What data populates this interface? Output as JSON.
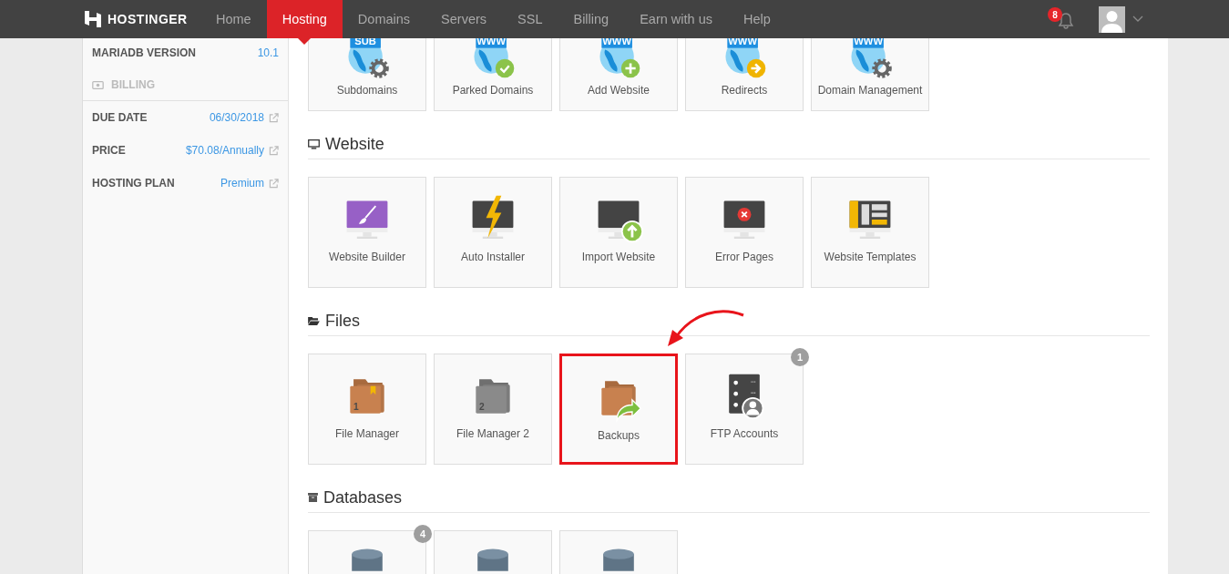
{
  "nav": {
    "logo": "HOSTINGER",
    "items": [
      {
        "label": "Home",
        "selected": false
      },
      {
        "label": "Hosting",
        "selected": true
      },
      {
        "label": "Domains",
        "selected": false
      },
      {
        "label": "Servers",
        "selected": false
      },
      {
        "label": "SSL",
        "selected": false
      },
      {
        "label": "Billing",
        "selected": false
      },
      {
        "label": "Earn with us",
        "selected": false
      },
      {
        "label": "Help",
        "selected": false
      }
    ],
    "notifications": "8"
  },
  "sidebar": {
    "rows": [
      {
        "label": "MARIADB VERSION",
        "value": "10.1",
        "link": false
      }
    ],
    "billing": {
      "title": "BILLING",
      "rows": [
        {
          "label": "DUE DATE",
          "value": "06/30/2018",
          "link": true
        },
        {
          "label": "PRICE",
          "value": "$70.08/Annually",
          "link": true
        },
        {
          "label": "HOSTING PLAN",
          "value": "Premium",
          "link": true
        }
      ]
    }
  },
  "sections": [
    {
      "kind": "globe",
      "tiles": [
        {
          "label": "Subdomains",
          "kind": "gear",
          "icon_text": "SUB",
          "highlighted": false
        },
        {
          "label": "Parked Domains",
          "kind": "check",
          "icon_text": "WWW",
          "highlighted": false
        },
        {
          "label": "Add Website",
          "kind": "plus",
          "icon_text": "WWW",
          "highlighted": false
        },
        {
          "label": "Redirects",
          "kind": "arrow",
          "icon_text": "WWW",
          "highlighted": false
        },
        {
          "label": "Domain Management",
          "kind": "gear",
          "icon_text": "WWW",
          "highlighted": false
        }
      ]
    },
    {
      "kind": "monitor",
      "title": "Website",
      "tiles": [
        {
          "label": "Website Builder",
          "kind": "brush",
          "highlighted": false
        },
        {
          "label": "Auto Installer",
          "kind": "bolt",
          "highlighted": false
        },
        {
          "label": "Import Website",
          "kind": "upload",
          "highlighted": false
        },
        {
          "label": "Error Pages",
          "kind": "error",
          "highlighted": false
        },
        {
          "label": "Website Templates",
          "kind": "template",
          "highlighted": false
        }
      ]
    },
    {
      "kind": "folder",
      "title": "Files",
      "tiles": [
        {
          "label": "File Manager",
          "kind": "bookmark",
          "icon_text": "1",
          "highlighted": false
        },
        {
          "label": "File Manager 2",
          "kind": "grey",
          "icon_text": "2",
          "highlighted": false
        },
        {
          "label": "Backups",
          "kind": "share",
          "highlighted": true
        },
        {
          "label": "FTP Accounts",
          "kind": "server",
          "count": "1",
          "highlighted": false
        }
      ]
    },
    {
      "kind": "database",
      "title": "Databases",
      "tiles": [
        {
          "kind": "database",
          "count": "4",
          "highlighted": false
        },
        {
          "kind": "database",
          "highlighted": false
        },
        {
          "kind": "database",
          "highlighted": false
        }
      ]
    }
  ]
}
